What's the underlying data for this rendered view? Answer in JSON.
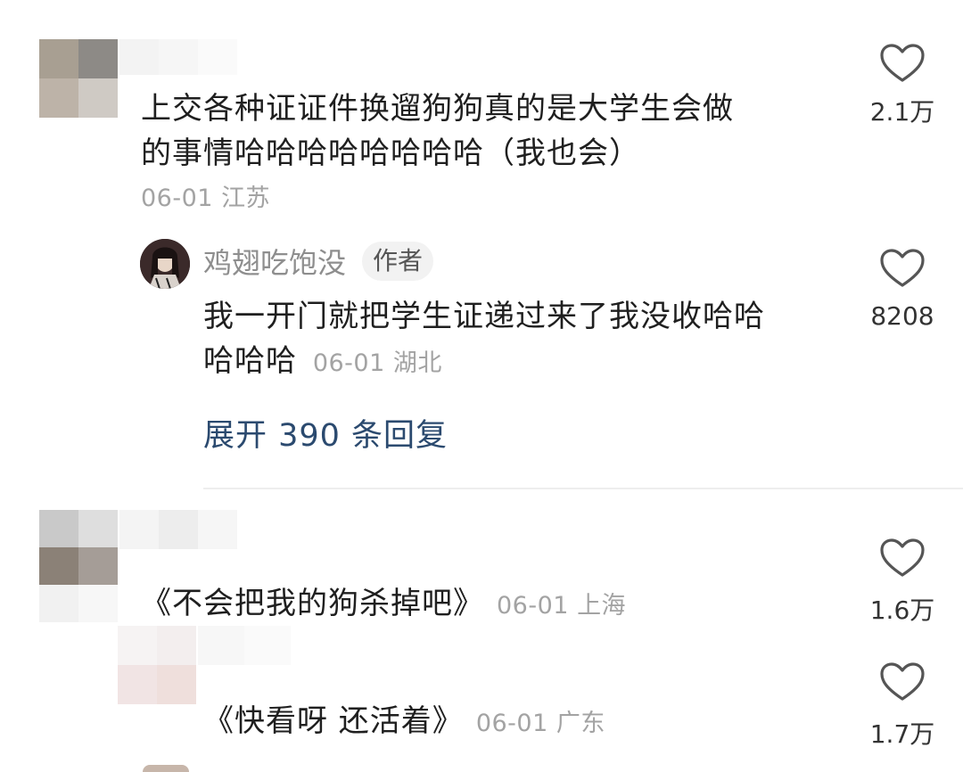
{
  "comments": [
    {
      "text_line1": "上交各种证证件换遛狗狗真的是大学生会做",
      "text_line2": "的事情哈哈哈哈哈哈哈哈（我也会）",
      "date": "06-01",
      "location": "江苏",
      "likes": "2.1万",
      "reply": {
        "author": "鸡翅吃饱没",
        "badge": "作者",
        "text_line1": "我一开门就把学生证递过来了我没收哈哈",
        "text_line2": "哈哈哈",
        "date": "06-01",
        "location": "湖北",
        "likes": "8208"
      },
      "expand_label": "展开 390 条回复"
    },
    {
      "text": "《不会把我的狗杀掉吧》",
      "date": "06-01",
      "location": "上海",
      "likes": "1.6万"
    },
    {
      "text": "《快看呀 还活着》",
      "date": "06-01",
      "location": "广东",
      "likes": "1.7万"
    }
  ],
  "icons": {
    "like": "heart-outline-icon"
  }
}
